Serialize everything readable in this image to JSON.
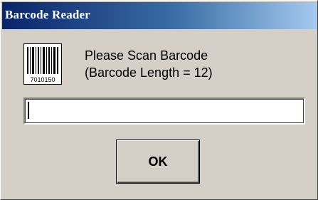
{
  "window": {
    "title": "Barcode Reader"
  },
  "dialog": {
    "icon": "barcode-icon",
    "icon_digits": "7010150",
    "prompt_line1": "Please Scan Barcode",
    "prompt_line2": "(Barcode Length = 12)",
    "input_value": "",
    "ok_label": "OK"
  },
  "colors": {
    "title_bar_start": "#0a246a",
    "title_bar_end": "#a6caf0",
    "dialog_bg": "#d4d0c8"
  }
}
